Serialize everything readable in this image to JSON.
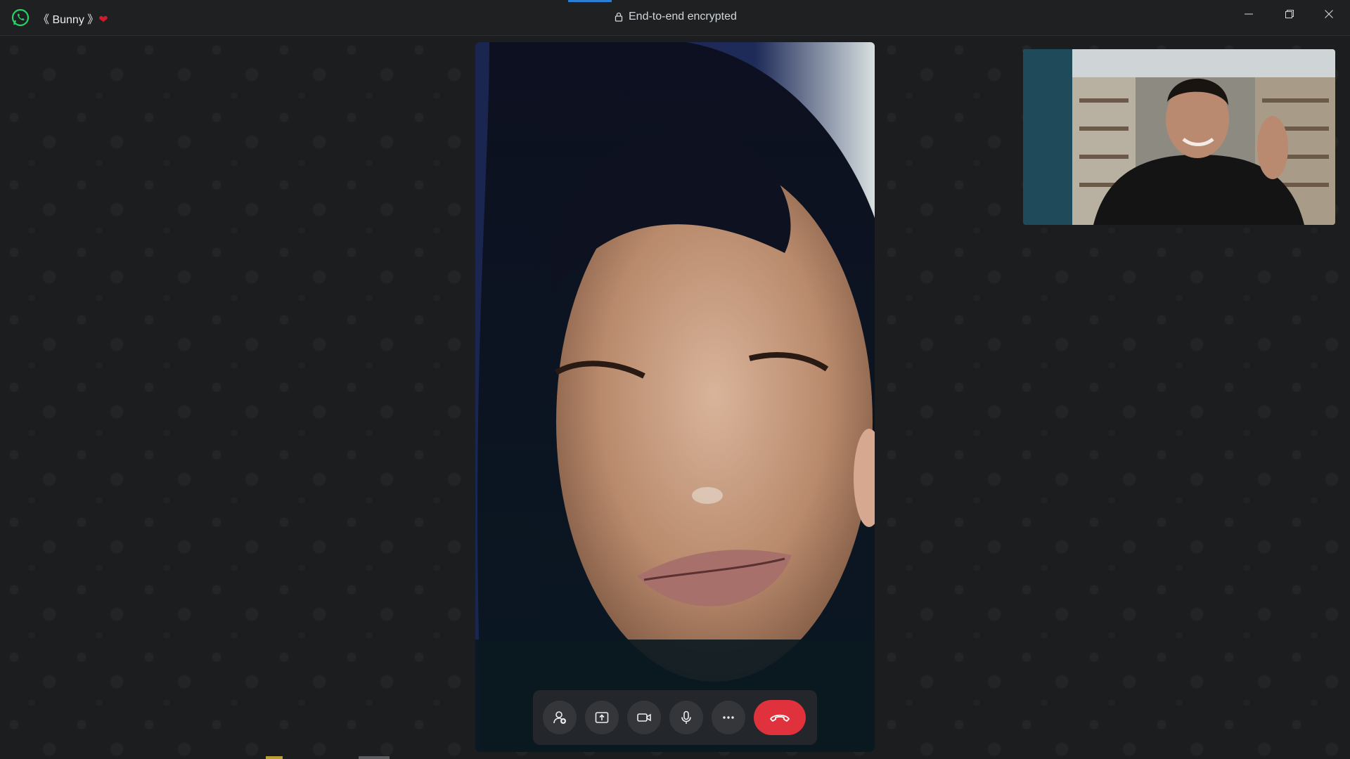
{
  "titlebar": {
    "contact_name": "《 Bunny 》",
    "encryption_label": "End-to-end encrypted"
  },
  "window_controls": [
    "minimize-icon",
    "restore-icon",
    "close-icon"
  ],
  "call_controls": [
    {
      "icon": "add-participant-icon"
    },
    {
      "icon": "share-screen-icon"
    },
    {
      "icon": "video-camera-icon"
    },
    {
      "icon": "microphone-icon"
    },
    {
      "icon": "more-options-icon"
    },
    {
      "icon": "end-call-icon"
    }
  ],
  "colors": {
    "accent": "#25d366",
    "end_call": "#e0323c",
    "background": "#1c1d1f"
  }
}
